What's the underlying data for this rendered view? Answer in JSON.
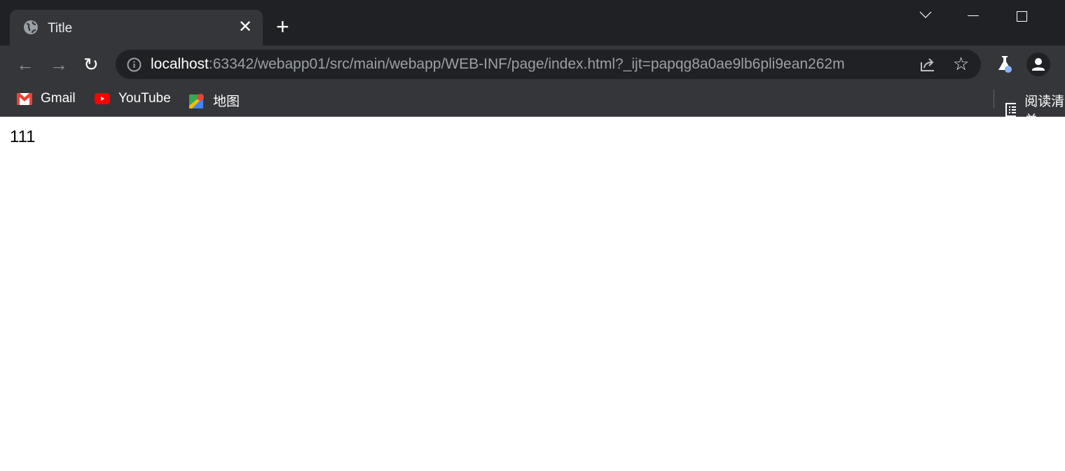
{
  "tab": {
    "title": "Title",
    "close_icon": "close-icon",
    "favicon": "globe-icon"
  },
  "newtab_label": "+",
  "window": {
    "dropdown": "chevron-down-icon",
    "minimize": "minimize-icon",
    "maximize": "maximize-icon"
  },
  "omnibox": {
    "host": "localhost",
    "rest": ":63342/webapp01/src/main/webapp/WEB-INF/page/index.html?_ijt=papqg8a0ae9lb6pli9ean262m"
  },
  "bookmarks": [
    {
      "label": "Gmail"
    },
    {
      "label": "YouTube"
    },
    {
      "label": "地图"
    }
  ],
  "reading_list": "阅读清单",
  "page": {
    "text": "111"
  },
  "colors": {
    "frame": "#202124",
    "toolbar": "#35363a",
    "accent": "#8ab4f8"
  }
}
